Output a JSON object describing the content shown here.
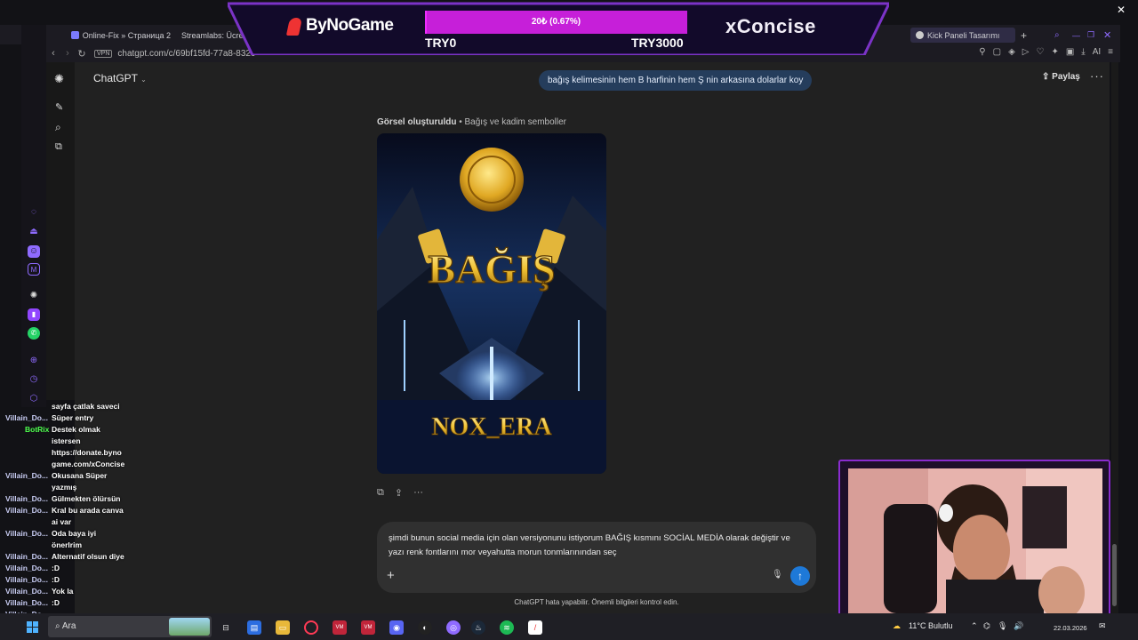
{
  "browser": {
    "tabs": [
      {
        "label": "Online-Fix » Страница 2",
        "icon": "online-fix-icon",
        "color": "#7b7bff"
      },
      {
        "label": "Streamlabs: Ücret...",
        "icon": "streamlabs-icon",
        "color": "#31c3a2"
      },
      {
        "label": "Kick Paneli Tasarımı",
        "icon": "chatgpt-icon",
        "color": "#cccccc"
      }
    ],
    "url": "chatgpt.com/c/69bf15fd-77a8-832c-",
    "vpn_label": "VPN",
    "ai_label": "AI"
  },
  "chatgpt": {
    "model_label": "ChatGPT",
    "share_label": "Paylaş",
    "user_message": "bağış kelimesinin hem B harfinin hem Ş nin arkasına dolarlar koy",
    "image_status": "Görsel oluşturuldu",
    "image_title": "Bağış ve kadim semboller",
    "image_heading": "BAĞIŞ",
    "image_footer": "NOX_ERA",
    "composer_text": "şimdi bunun social media için olan versiyonunu istiyorum BAĞIŞ kısmını SOCİAL MEDİA olarak değiştir ve yazı renk fontlarını mor veyahutta morun tonmlarınından seç",
    "disclaimer": "ChatGPT hata yapabilir. Önemli bilgileri kontrol edin."
  },
  "donation": {
    "brand": "ByNoGame",
    "progress_label": "20₺ (0.67%)",
    "progress": 0.0067,
    "min_label": "TRY0",
    "max_label": "TRY3000",
    "streamer": "xConcise"
  },
  "stream_chat": [
    {
      "user": "",
      "msg": "sayfa çatlak saveci"
    },
    {
      "user": "Villain_Do...",
      "msg": "Süper entry"
    },
    {
      "user": "BotRix",
      "msg": "Destek olmak"
    },
    {
      "user": "",
      "msg": "istersen"
    },
    {
      "user": "",
      "msg": "https://donate.byno"
    },
    {
      "user": "",
      "msg": "game.com/xConcise"
    },
    {
      "user": "Villain_Do...",
      "msg": "Okusana Süper"
    },
    {
      "user": "",
      "msg": "yazmış"
    },
    {
      "user": "Villain_Do...",
      "msg": "Gülmekten ölürsün"
    },
    {
      "user": "Villain_Do...",
      "msg": "Kral bu arada canva"
    },
    {
      "user": "",
      "msg": "ai var"
    },
    {
      "user": "Villain_Do...",
      "msg": "Oda baya iyi"
    },
    {
      "user": "",
      "msg": "önerlrim"
    },
    {
      "user": "Villain_Do...",
      "msg": "Alternatif olsun diye"
    },
    {
      "user": "Villain_Do...",
      "msg": ":D"
    },
    {
      "user": "Villain_Do...",
      "msg": ":D"
    },
    {
      "user": "Villain_Do...",
      "msg": "Yok la"
    },
    {
      "user": "Villain_Do...",
      "msg": ":D"
    },
    {
      "user": "Villain_Do...",
      "msg": ""
    }
  ],
  "taskbar": {
    "search_label": "Ara",
    "weather": "11°C Bulutlu",
    "date": "22.03.2026"
  },
  "colors": {
    "accent": "#1e79d8",
    "donate_bar": "#c61fd9",
    "webcam_border": "#8a2ccf",
    "botrix": "#4dff4d"
  }
}
